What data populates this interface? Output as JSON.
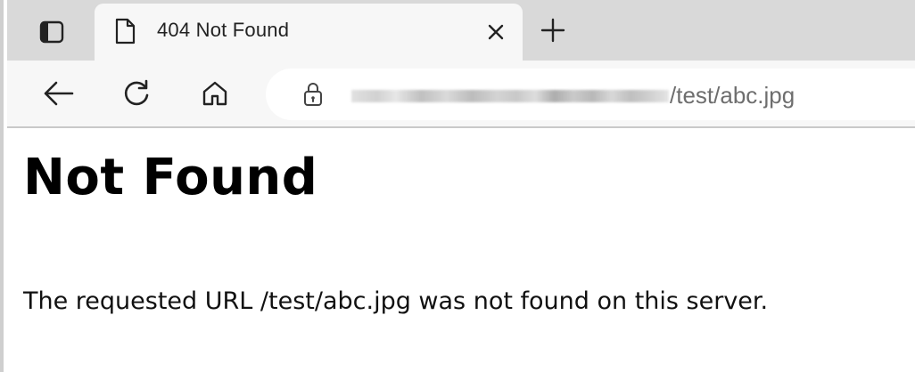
{
  "browser": {
    "tab": {
      "title": "404 Not Found"
    },
    "address_bar": {
      "url_visible_suffix": "/test/abc.jpg"
    }
  },
  "page": {
    "heading": "Not Found",
    "message": "The requested URL /test/abc.jpg was not found on this server."
  }
}
